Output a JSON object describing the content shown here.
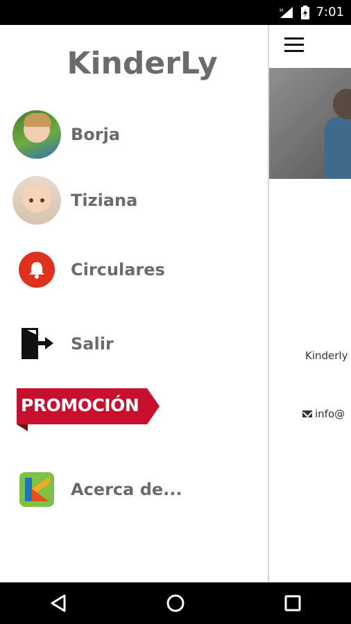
{
  "status_bar": {
    "time": "7:01"
  },
  "drawer": {
    "title": "KinderLy",
    "items": [
      {
        "label": "Borja",
        "icon": "avatar-borja"
      },
      {
        "label": "Tiziana",
        "icon": "avatar-tiziana"
      },
      {
        "label": "Circulares",
        "icon": "bell-icon"
      },
      {
        "label": "Salir",
        "icon": "exit-door-icon"
      },
      {
        "label": "Acerca de...",
        "icon": "kinderly-logo-icon"
      }
    ],
    "promo": {
      "label": "PROMOCIÓN",
      "color": "#c8102e"
    }
  },
  "background_app": {
    "text1": "Kinderly",
    "text2": "info@"
  },
  "colors": {
    "title_gray": "#6b6b6b",
    "bell_red": "#e0301e"
  }
}
